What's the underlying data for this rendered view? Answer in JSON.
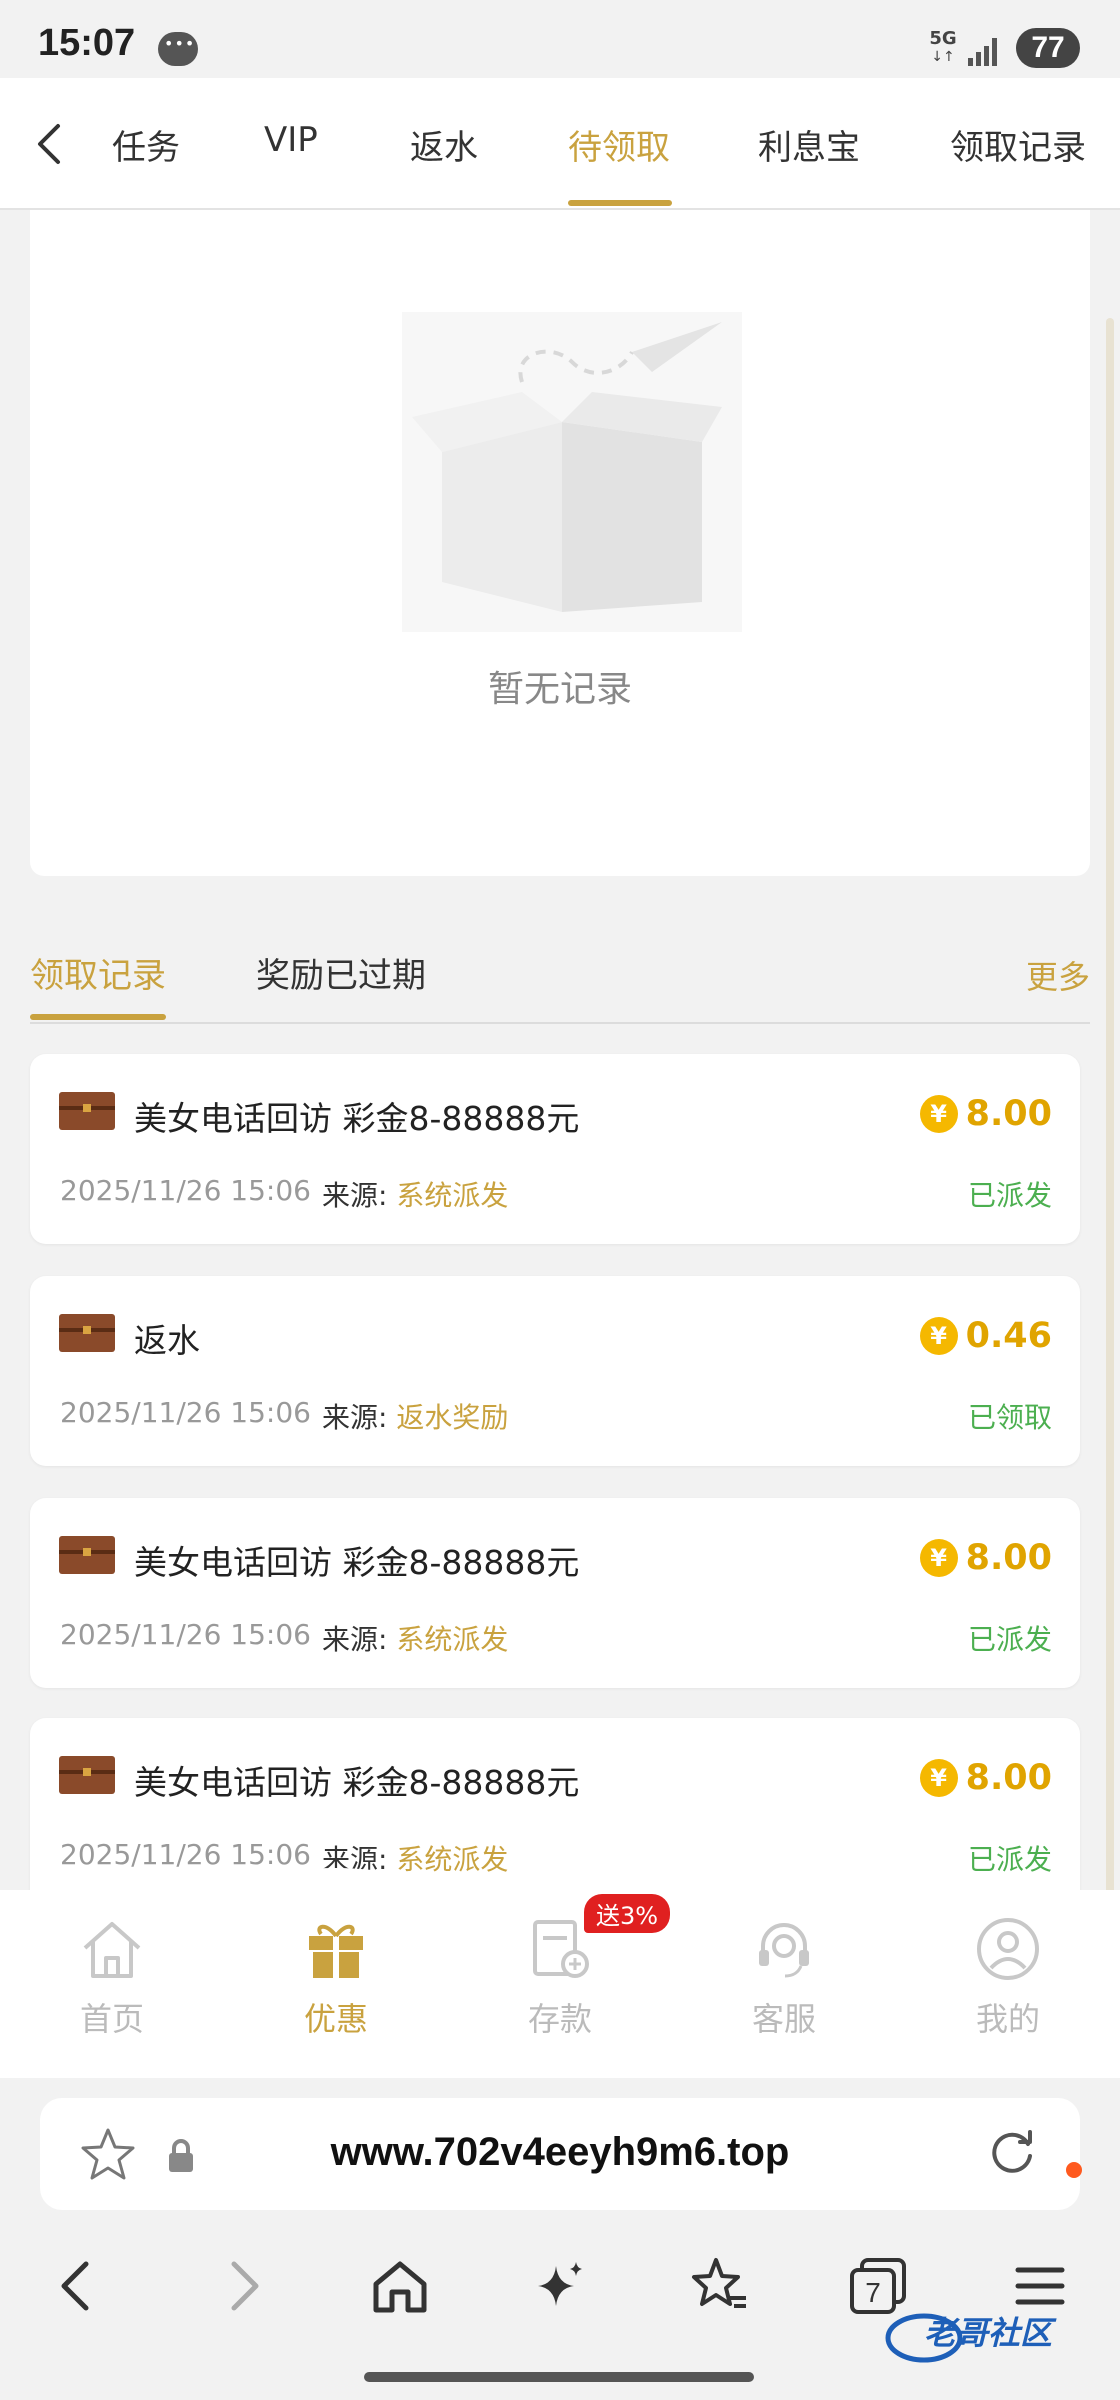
{
  "status": {
    "time": "15:07",
    "network": "5G",
    "battery": "77"
  },
  "topnav": {
    "tabs": [
      "任务",
      "VIP",
      "返水",
      "待领取",
      "利息宝",
      "领取记录"
    ],
    "active": "待领取"
  },
  "empty": {
    "text": "暂无记录"
  },
  "records_tabs": {
    "tab1": "领取记录",
    "tab2": "奖励已过期",
    "more": "更多"
  },
  "records": [
    {
      "title": "美女电话回访 彩金8-88888元",
      "amount": "8.00",
      "date": "2025/11/26 15:06",
      "source_label": "来源:",
      "source": "系统派发",
      "status": "已派发"
    },
    {
      "title": "返水",
      "amount": "0.46",
      "date": "2025/11/26 15:06",
      "source_label": "来源:",
      "source": "返水奖励",
      "status": "已领取"
    },
    {
      "title": "美女电话回访 彩金8-88888元",
      "amount": "8.00",
      "date": "2025/11/26 15:06",
      "source_label": "来源:",
      "source": "系统派发",
      "status": "已派发"
    },
    {
      "title": "美女电话回访 彩金8-88888元",
      "amount": "8.00",
      "date": "2025/11/26 15:06",
      "source_label": "来源:",
      "source": "系统派发",
      "status": "已派发"
    }
  ],
  "coin_symbol": "¥",
  "tabbar": {
    "items": [
      "首页",
      "优惠",
      "存款",
      "客服",
      "我的"
    ],
    "active": "优惠",
    "badge": "送3%"
  },
  "browser": {
    "url": "www.702v4eeyh9m6.top",
    "tab_count": "7"
  },
  "watermark": "老哥社区",
  "colors": {
    "accent": "#c9a23f",
    "coin": "#f5b800",
    "status_green": "#4caf50",
    "badge_red": "#e02020"
  }
}
